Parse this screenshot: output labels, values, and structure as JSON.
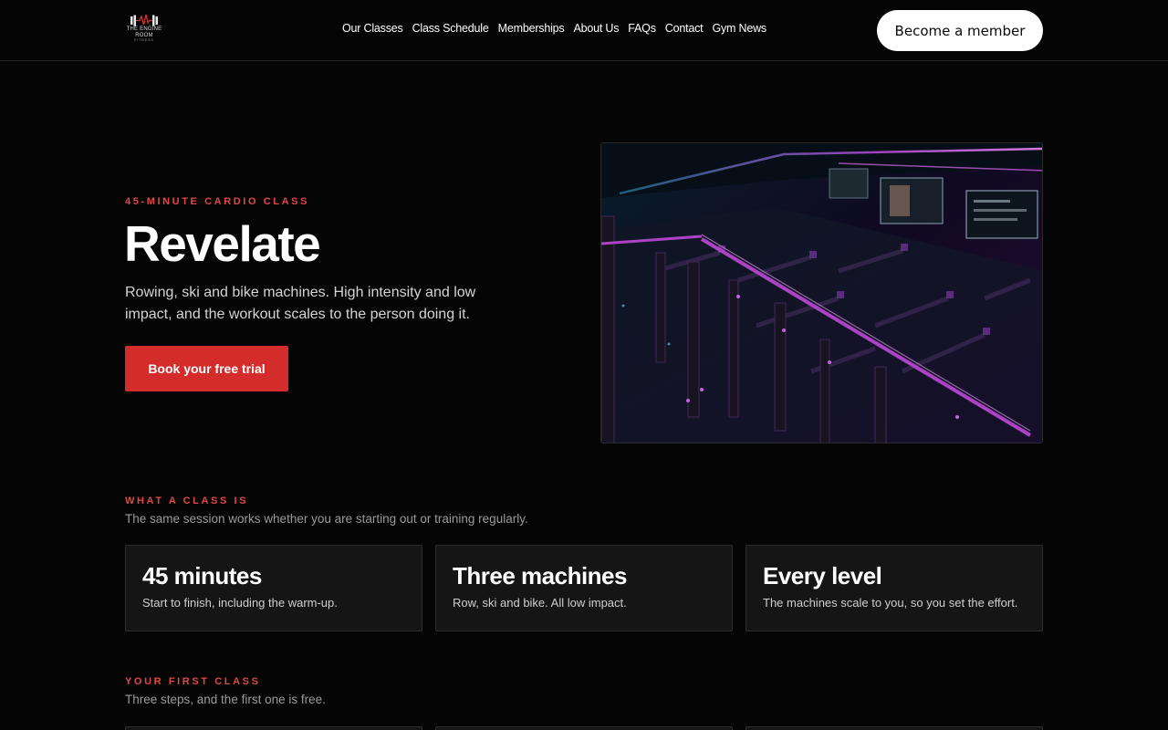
{
  "header": {
    "logo": {
      "line1": "THE ENGINE",
      "line2": "ROOM",
      "line3": "FITNESS"
    },
    "nav": [
      "Our Classes",
      "Class Schedule",
      "Memberships",
      "About Us",
      "FAQs",
      "Contact",
      "Gym News"
    ],
    "cta": "Become a member"
  },
  "hero": {
    "eyebrow": "45-MINUTE CARDIO CLASS",
    "title": "Revelate",
    "description": "Rowing, ski and bike machines. High intensity and low impact, and the workout scales to the person doing it.",
    "button": "Book your free trial"
  },
  "what_a_class_is": {
    "eyebrow": "WHAT A CLASS IS",
    "subtitle": "The same session works whether you are starting out or training regularly.",
    "cards": [
      {
        "title": "45 minutes",
        "desc": "Start to finish, including the warm-up."
      },
      {
        "title": "Three machines",
        "desc": "Row, ski and bike. All low impact."
      },
      {
        "title": "Every level",
        "desc": "The machines scale to you, so you set the effort."
      }
    ]
  },
  "first_class": {
    "eyebrow": "YOUR FIRST CLASS",
    "subtitle": "Three steps, and the first one is free."
  },
  "colors": {
    "accent": "#d42b2b",
    "eyebrow": "#e04848",
    "background": "#050505",
    "card": "#151515"
  }
}
